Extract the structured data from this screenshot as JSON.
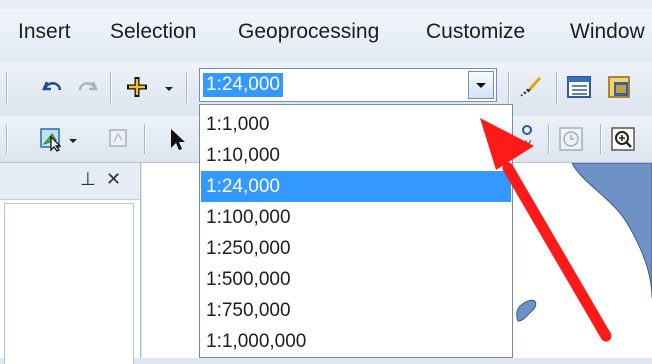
{
  "menubar": {
    "items": [
      {
        "label": "Insert"
      },
      {
        "label": "Selection"
      },
      {
        "label": "Geoprocessing"
      },
      {
        "label": "Customize"
      },
      {
        "label": "Window"
      }
    ]
  },
  "scale_box": {
    "value": "1:24,000",
    "options": [
      "1:1,000",
      "1:10,000",
      "1:24,000",
      "1:100,000",
      "1:250,000",
      "1:500,000",
      "1:750,000",
      "1:1,000,000"
    ],
    "selected_index": 2
  },
  "panel": {
    "pin_glyph": "⊥",
    "close_glyph": "✕"
  },
  "toolbar_icons": [
    "undo-icon",
    "redo-icon",
    "add-data-icon",
    "dropdown-arrow-icon",
    "editor-icon",
    "table-icon",
    "catalog-icon",
    "select-features-icon",
    "clear-selection-icon",
    "select-elements-icon",
    "identify-icon",
    "time-slider-icon",
    "zoom-icon"
  ],
  "colors": {
    "selection": "#3399ff",
    "map_water": "#6f92c6",
    "annotation_arrow": "#ff1a1a"
  }
}
